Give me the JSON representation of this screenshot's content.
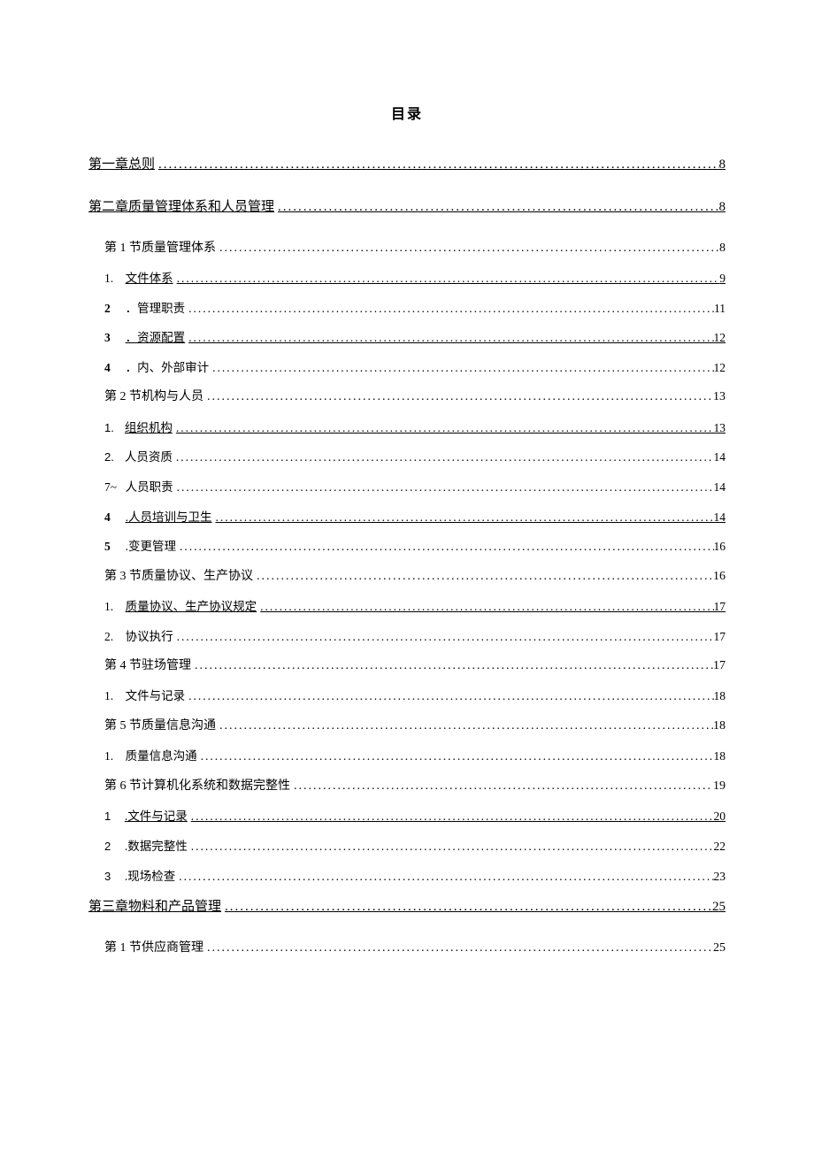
{
  "title": "目录",
  "entries": [
    {
      "level": 1,
      "text": "第一章总则",
      "page": "8",
      "underline": true,
      "bold": false
    },
    {
      "level": 1,
      "text": "第二章质量管理体系和人员管理",
      "page": "8",
      "underline": true,
      "bold": false
    },
    {
      "level": 2,
      "text": "第 1 节质量管理体系",
      "page": "8",
      "underline": false
    },
    {
      "level": 3,
      "prefix": "1.",
      "text": "文件体系",
      "page": "9",
      "underline": true
    },
    {
      "level": 3,
      "prefix": "2",
      "text": "．管理职责",
      "page": "11",
      "underline": false,
      "boldPrefix": true
    },
    {
      "level": 3,
      "prefix": "3",
      "text": "．资源配置",
      "page": "12",
      "underline": true,
      "boldPrefix": true
    },
    {
      "level": 3,
      "prefix": "4",
      "text": "．内、外部审计",
      "page": "12",
      "underline": false,
      "boldPrefix": true
    },
    {
      "level": 2,
      "text": "第 2 节机构与人员",
      "page": "13",
      "underline": false
    },
    {
      "level": 3,
      "prefix": "1.",
      "text": "组织机构",
      "page": "13",
      "underline": true,
      "sansPrefix": true
    },
    {
      "level": 3,
      "prefix": "2.",
      "text": "人员资质",
      "page": "14",
      "underline": false,
      "sansPrefix": true
    },
    {
      "level": 3,
      "prefix": "7~",
      "text": "人员职责",
      "page": "14",
      "underline": false
    },
    {
      "level": 3,
      "prefix": "4",
      "text": ".人员培训与卫生",
      "page": "14",
      "underline": true,
      "boldPrefix": true
    },
    {
      "level": 3,
      "prefix": "5",
      "text": ".变更管理",
      "page": "16",
      "underline": false,
      "boldPrefix": true
    },
    {
      "level": 2,
      "text": "第 3 节质量协议、生产协议",
      "page": "16",
      "underline": false,
      "indent2": true
    },
    {
      "level": 3,
      "prefix": "1.",
      "text": "质量协议、生产协议规定",
      "page": "17",
      "underline": true
    },
    {
      "level": 3,
      "prefix": "2.",
      "text": "协议执行",
      "page": "17",
      "underline": false
    },
    {
      "level": 2,
      "text": "第 4 节驻场管理",
      "page": "17",
      "underline": false
    },
    {
      "level": 3,
      "prefix": "1.",
      "text": "文件与记录",
      "page": "18",
      "underline": false
    },
    {
      "level": 2,
      "text": "第 5 节质量信息沟通",
      "page": "18",
      "underline": false
    },
    {
      "level": 3,
      "prefix": "1.",
      "text": "质量信息沟通",
      "page": "18",
      "underline": false,
      "boldPrefix2": true
    },
    {
      "level": 2,
      "text": "第 6 节计算机化系统和数据完整性",
      "page": "19",
      "underline": false
    },
    {
      "level": 3,
      "prefix": "1",
      "text": ".文件与记录",
      "page": "20",
      "underline": true,
      "sansPrefix": true
    },
    {
      "level": 3,
      "prefix": "2",
      "text": ".数据完整性",
      "page": "22",
      "underline": false,
      "sansPrefix": true
    },
    {
      "level": 3,
      "prefix": "3",
      "text": ".现场检查",
      "page": "23",
      "underline": false,
      "sansPrefix": true
    },
    {
      "level": 1,
      "text": "第三章物料和产品管理",
      "page": "25",
      "underline": true,
      "bold": false
    },
    {
      "level": 2,
      "text": "第 1 节供应商管理",
      "page": "25",
      "underline": false
    }
  ]
}
